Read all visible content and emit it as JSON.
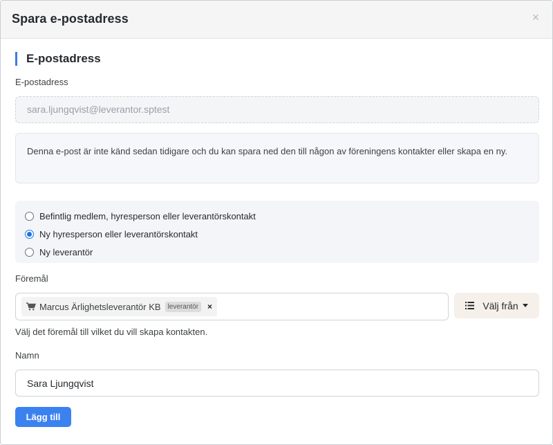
{
  "dialog": {
    "title": "Spara e-postadress",
    "close_glyph": "×"
  },
  "section": {
    "title": "E-postadress"
  },
  "email": {
    "label": "E-postadress",
    "value": "sara.ljungqvist@leverantor.sptest"
  },
  "info": {
    "text": "Denna e-post är inte känd sedan tidigare och du kan spara ned den till någon av föreningens kontakter eller skapa en ny."
  },
  "contact_options": {
    "items": [
      {
        "label": "Befintlig medlem, hyresperson eller leverantörskontakt",
        "checked": false
      },
      {
        "label": "Ny hyresperson eller leverantörskontakt",
        "checked": true
      },
      {
        "label": "Ny leverantör",
        "checked": false
      }
    ]
  },
  "object": {
    "label": "Föremål",
    "tag": {
      "icon": "shopping-cart-icon",
      "name": "Marcus Ärlighetsleverantör KB",
      "badge": "leverantör",
      "remove_glyph": "×"
    },
    "choose_button": {
      "icon": "list-icon",
      "label": "Välj från"
    },
    "help": "Välj det föremål till vilket du vill skapa kontakten."
  },
  "name": {
    "label": "Namn",
    "value": "Sara Ljungqvist"
  },
  "actions": {
    "add_label": "Lägg till"
  },
  "colors": {
    "accent": "#3b82f0",
    "section_bar": "#3a7de0",
    "radio_checked": "#1a73e8"
  }
}
